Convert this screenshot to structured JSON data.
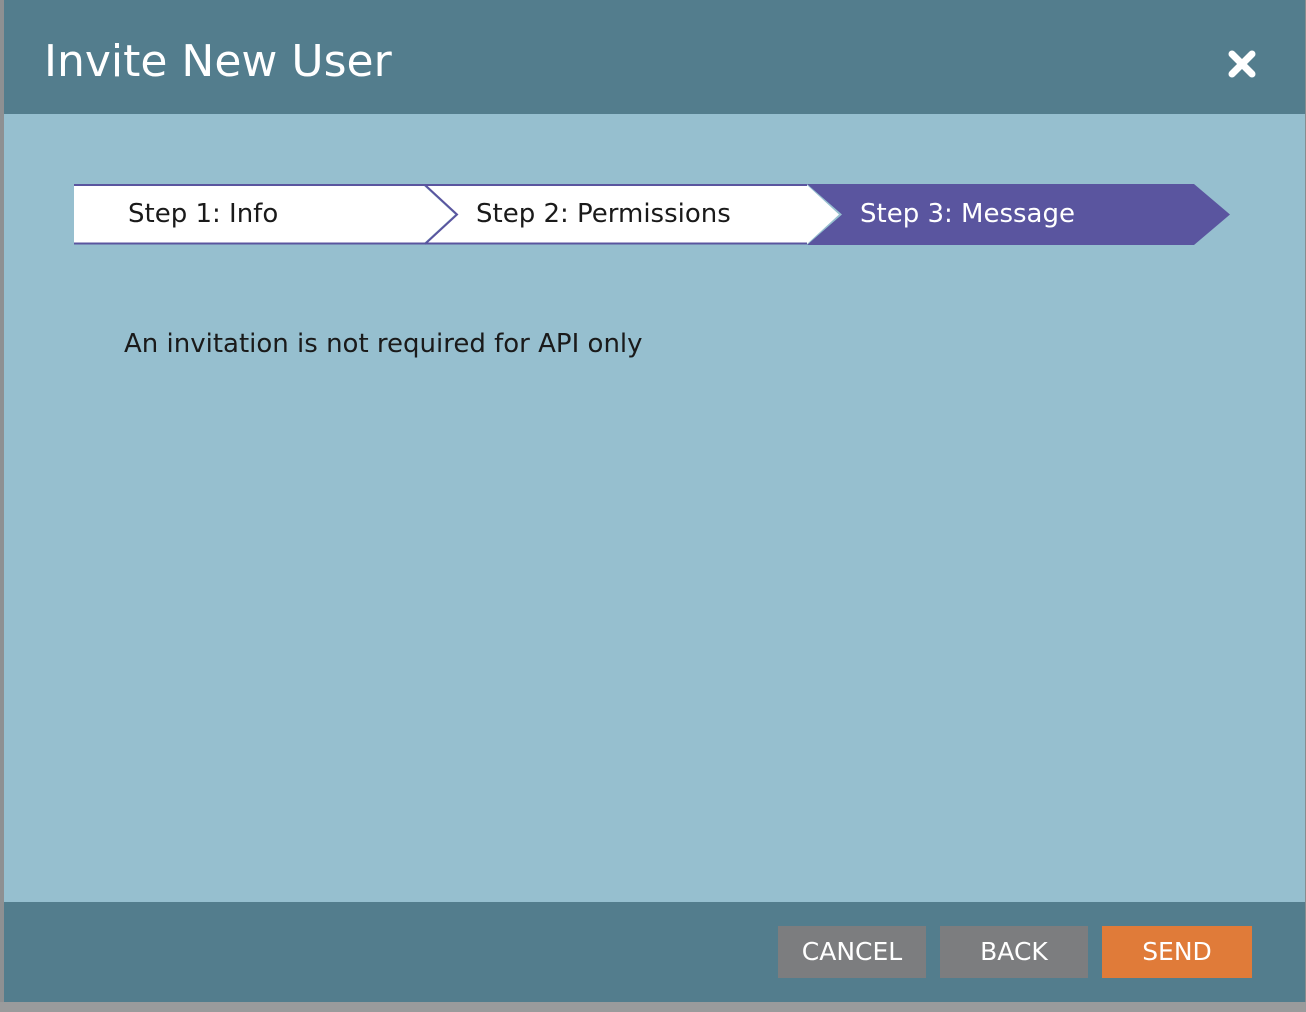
{
  "dialog": {
    "title": "Invite New User",
    "close_icon": "close-icon"
  },
  "stepper": {
    "steps": [
      {
        "label": "Step 1: Info",
        "state": "inactive"
      },
      {
        "label": "Step 2: Permissions",
        "state": "inactive"
      },
      {
        "label": "Step 3: Message",
        "state": "active"
      }
    ]
  },
  "body": {
    "message": "An invitation is not required for API only"
  },
  "footer": {
    "cancel_label": "CANCEL",
    "back_label": "BACK",
    "send_label": "SEND"
  },
  "colors": {
    "header_bg": "#537d8d",
    "body_bg": "#96bfcf",
    "active_step": "#5a559f",
    "inactive_step": "#ffffff",
    "step_border": "#5a559f",
    "secondary_button": "#7c7d7f",
    "primary_button": "#e07b39"
  }
}
